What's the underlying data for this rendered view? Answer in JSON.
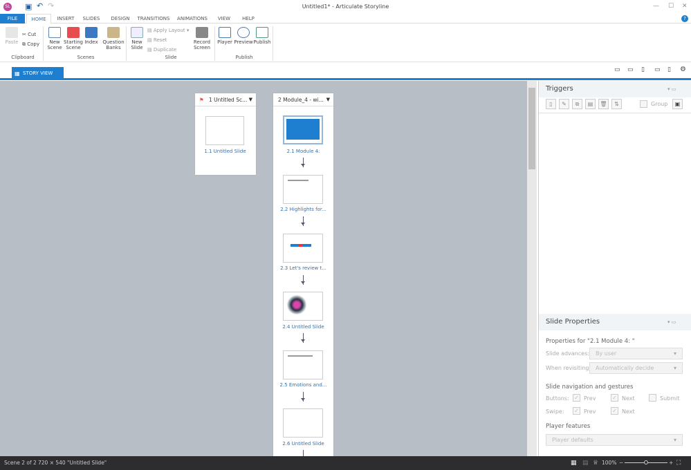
{
  "app": {
    "logo": "SL",
    "title": "Untitled1* -  Articulate Storyline"
  },
  "tabs": [
    "FILE",
    "HOME",
    "INSERT",
    "SLIDES",
    "DESIGN",
    "TRANSITIONS",
    "ANIMATIONS",
    "VIEW",
    "HELP"
  ],
  "ribbon": {
    "paste": "Paste",
    "cut": "Cut",
    "copy": "Copy",
    "clipboard": "Clipboard",
    "new_scene": "New Scene",
    "starting_scene": "Starting Scene",
    "index": "Index",
    "question_banks": "Question Banks",
    "scenes": "Scenes",
    "new_slide": "New Slide",
    "apply_layout": "Apply Layout",
    "reset": "Reset",
    "duplicate": "Duplicate",
    "record_screen": "Record Screen",
    "slide": "Slide",
    "player": "Player",
    "preview": "Preview",
    "publish": "Publish",
    "publish_group": "Publish"
  },
  "view_tab": "STORY VIEW",
  "scenes": [
    {
      "title": "1 Untitled Sc...",
      "slides": [
        "1.1 Untitled Slide"
      ]
    },
    {
      "title": "2 Module_4 - wi...",
      "slides": [
        "2.1 Module 4:",
        "2.2 Highlights for...",
        "2.3 Let's review t...",
        "2.4 Untitled Slide",
        "2.5 Emotions and...",
        "2.6 Untitled Slide"
      ]
    }
  ],
  "triggers": {
    "title": "Triggers",
    "group": "Group"
  },
  "props": {
    "title": "Slide Properties",
    "for": "Properties for \"2.1 Module 4: \"",
    "advances_label": "Slide advances:",
    "advances_value": "By user",
    "revisit_label": "When revisiting:",
    "revisit_value": "Automatically decide",
    "nav_head": "Slide navigation and gestures",
    "buttons": "Buttons:",
    "swipe": "Swipe:",
    "prev": "Prev",
    "next": "Next",
    "submit": "Submit",
    "player_head": "Player features",
    "player_value": "Player defaults"
  },
  "status": {
    "scene": "Scene 2 of 2",
    "size": "720 × 540",
    "slide": "\"Untitled Slide\"",
    "zoom": "100%"
  },
  "colors": {
    "accent": "#1e7fd0",
    "canvas": "#b8bec6"
  }
}
